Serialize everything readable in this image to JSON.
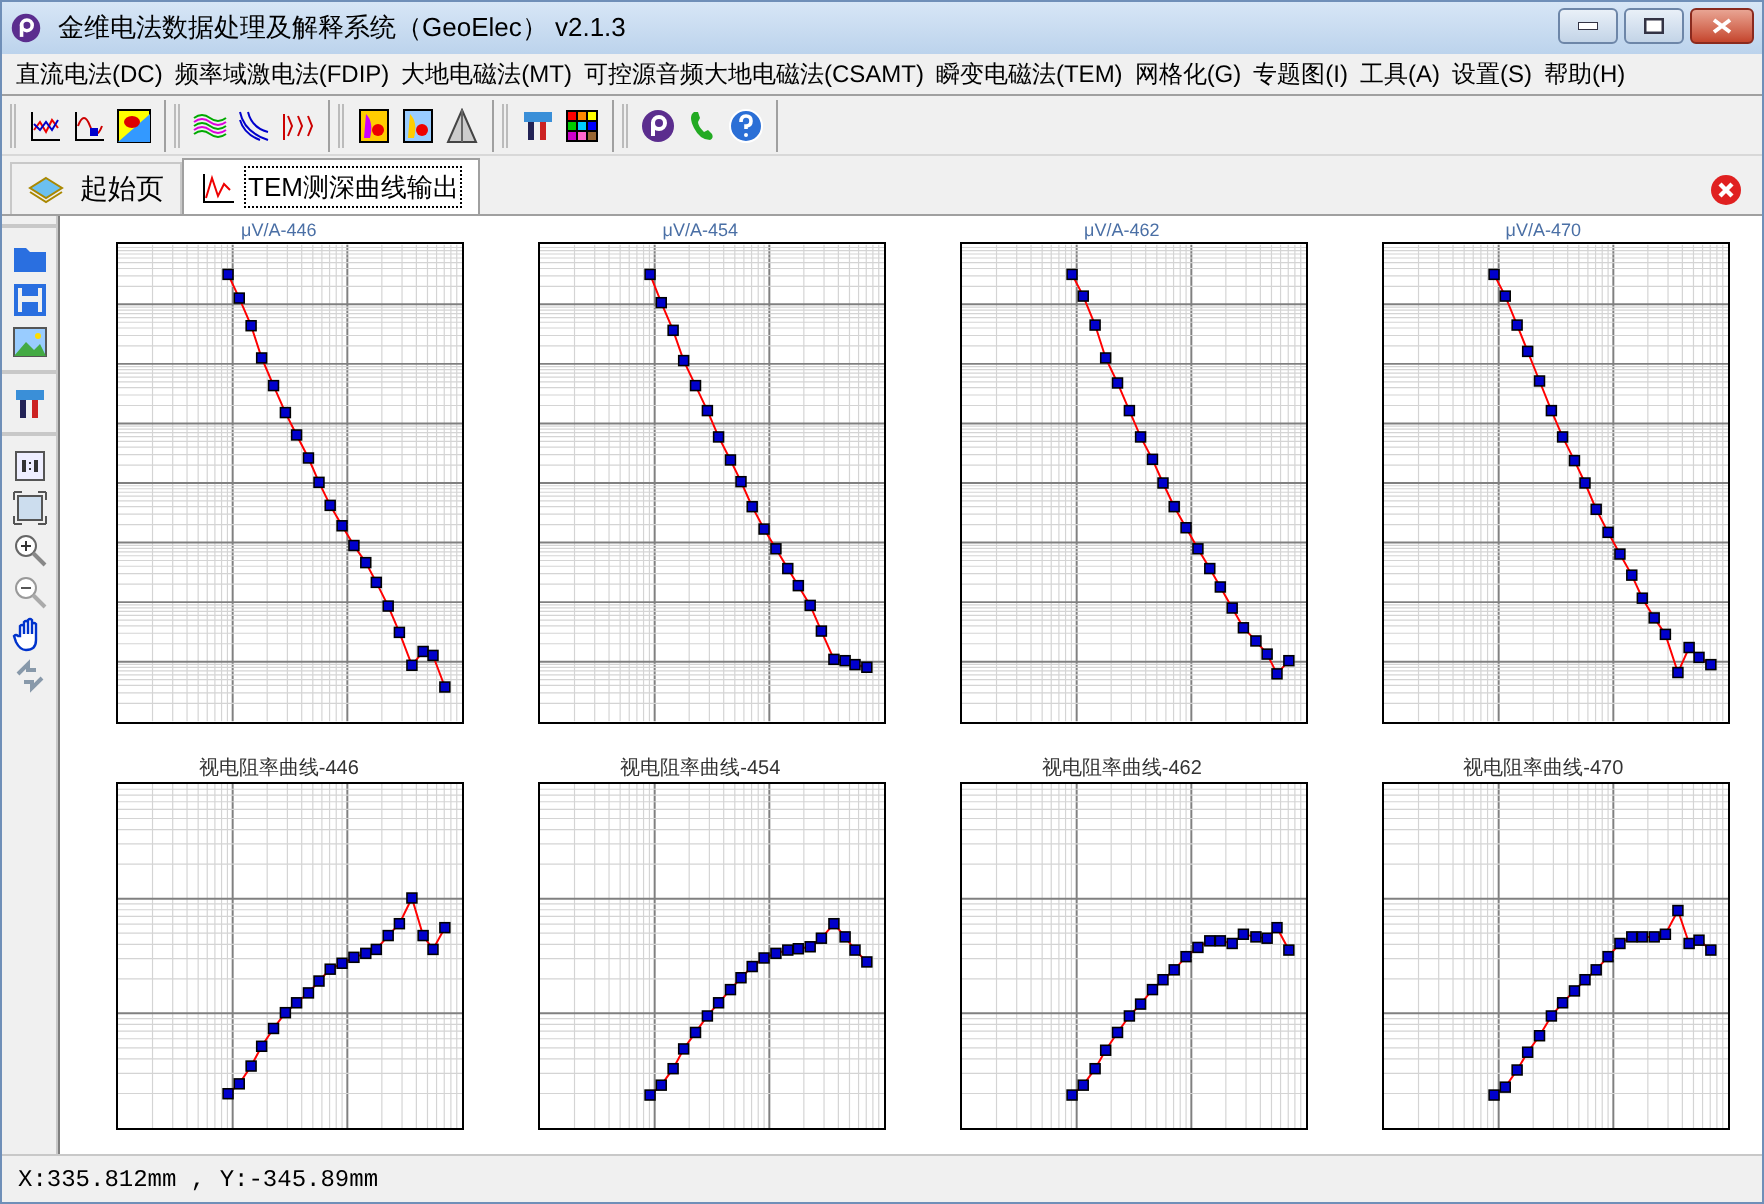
{
  "window": {
    "title": "金维电法数据处理及解释系统（GeoElec） v2.1.3"
  },
  "menu": [
    {
      "label": "直流电法(DC)"
    },
    {
      "label": "频率域激电法(FDIP)"
    },
    {
      "label": "大地电磁法(MT)"
    },
    {
      "label": "可控源音频大地电磁法(CSAMT)"
    },
    {
      "label": "瞬变电磁法(TEM)"
    },
    {
      "label": "网格化(G)"
    },
    {
      "label": "专题图(I)"
    },
    {
      "label": "工具(A)"
    },
    {
      "label": "设置(S)"
    },
    {
      "label": "帮助(H)"
    }
  ],
  "tabs": [
    {
      "label": "起始页",
      "selected": false
    },
    {
      "label": "TEM测深曲线输出",
      "selected": true
    }
  ],
  "charts": [
    {
      "title": "μV/A-446"
    },
    {
      "title": "μV/A-454"
    },
    {
      "title": "μV/A-462"
    },
    {
      "title": "μV/A-470"
    },
    {
      "title": "视电阻率曲线-446"
    },
    {
      "title": "视电阻率曲线-454"
    },
    {
      "title": "视电阻率曲线-462"
    },
    {
      "title": "视电阻率曲线-470"
    }
  ],
  "status_bar": {
    "text": "X:335.812mm , Y:-345.89mm"
  }
}
